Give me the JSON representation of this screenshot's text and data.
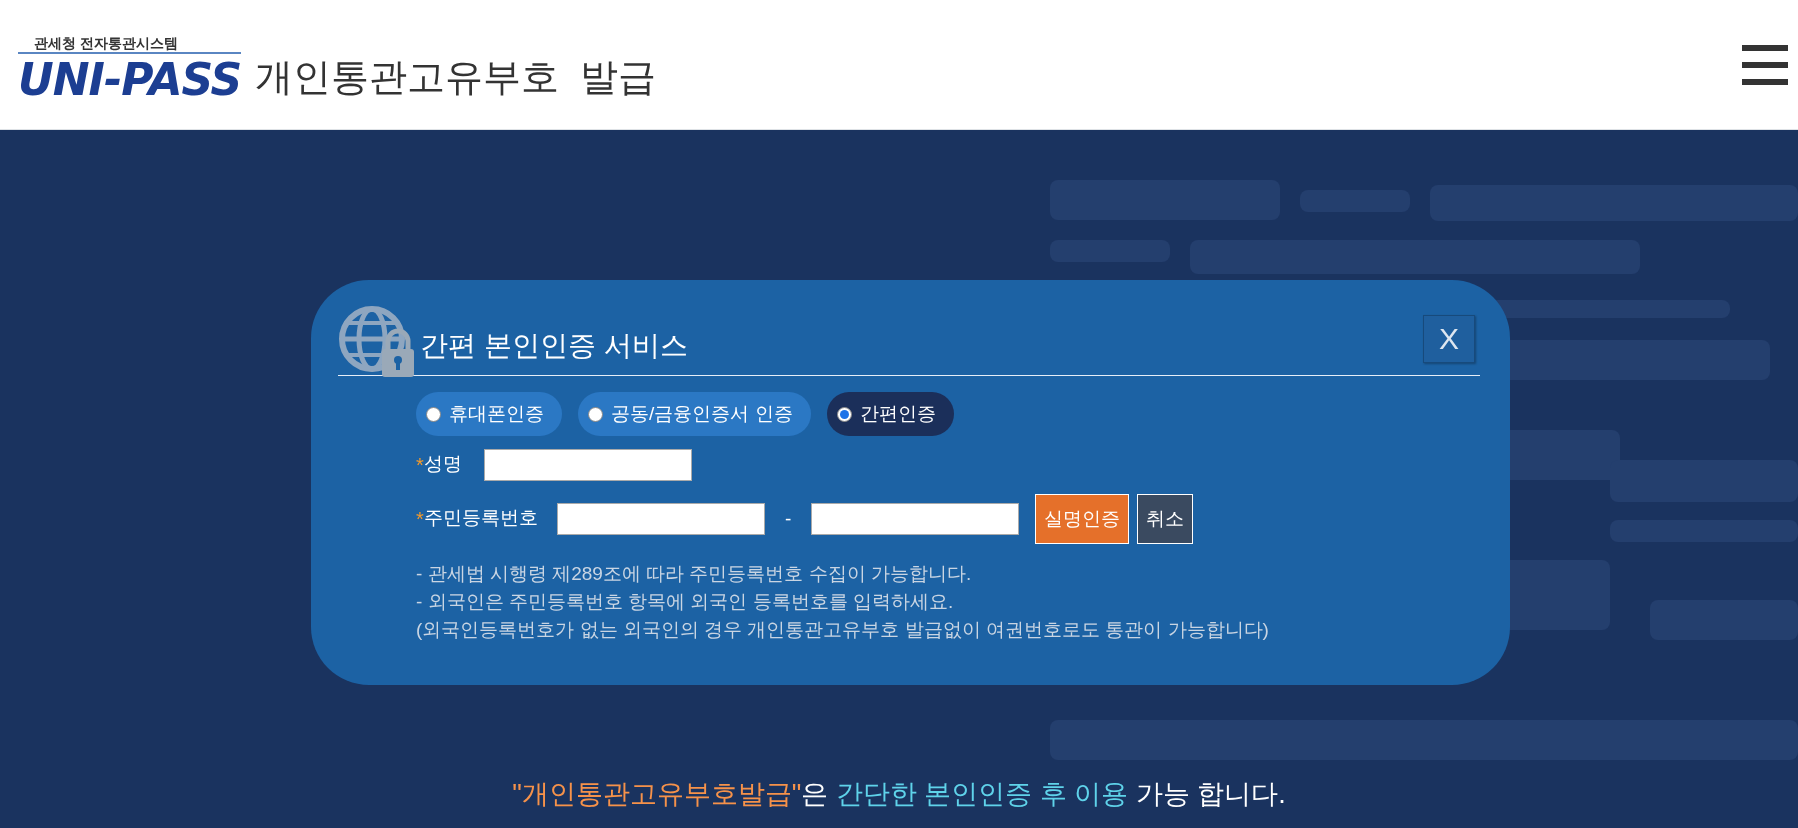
{
  "header": {
    "agency": "관세청  전자통관시스템",
    "logo": "UNI-PASS",
    "title": "개인통관고유부호  발급"
  },
  "dialog": {
    "title": "간편 본인인증 서비스",
    "close": "X",
    "methods": [
      {
        "label": "휴대폰인증",
        "selected": false
      },
      {
        "label": "공동/금융인증서 인증",
        "selected": false
      },
      {
        "label": "간편인증",
        "selected": true
      }
    ],
    "fields": [
      {
        "required": "*",
        "label": "성명",
        "kind": "single"
      },
      {
        "required": "*",
        "label": "주민등록번호",
        "kind": "split",
        "separator": "-"
      }
    ],
    "buttons": [
      {
        "label": "실명인증",
        "kind": "primary"
      },
      {
        "label": "취소",
        "kind": "secondary"
      }
    ],
    "notes": [
      "- 관세법 시행령 제289조에 따라 주민등록번호 수집이 가능합니다.",
      "- 외국인은 주민등록번호 항목에 외국인 등록번호를 입력하세요.",
      "(외국인등록번호가 없는 외국인의 경우 개인통관고유부호 발급없이 여권번호로도 통관이 가능합니다)"
    ]
  },
  "footer_message": [
    {
      "text": "\"개인통관고유부호발급\"",
      "kind": "quote"
    },
    {
      "text": "은 ",
      "kind": "plain"
    },
    {
      "text": "간단한 본인인증 후 이용",
      "kind": "emphasis"
    },
    {
      "text": " 가능 합니다.",
      "kind": "plain"
    }
  ]
}
